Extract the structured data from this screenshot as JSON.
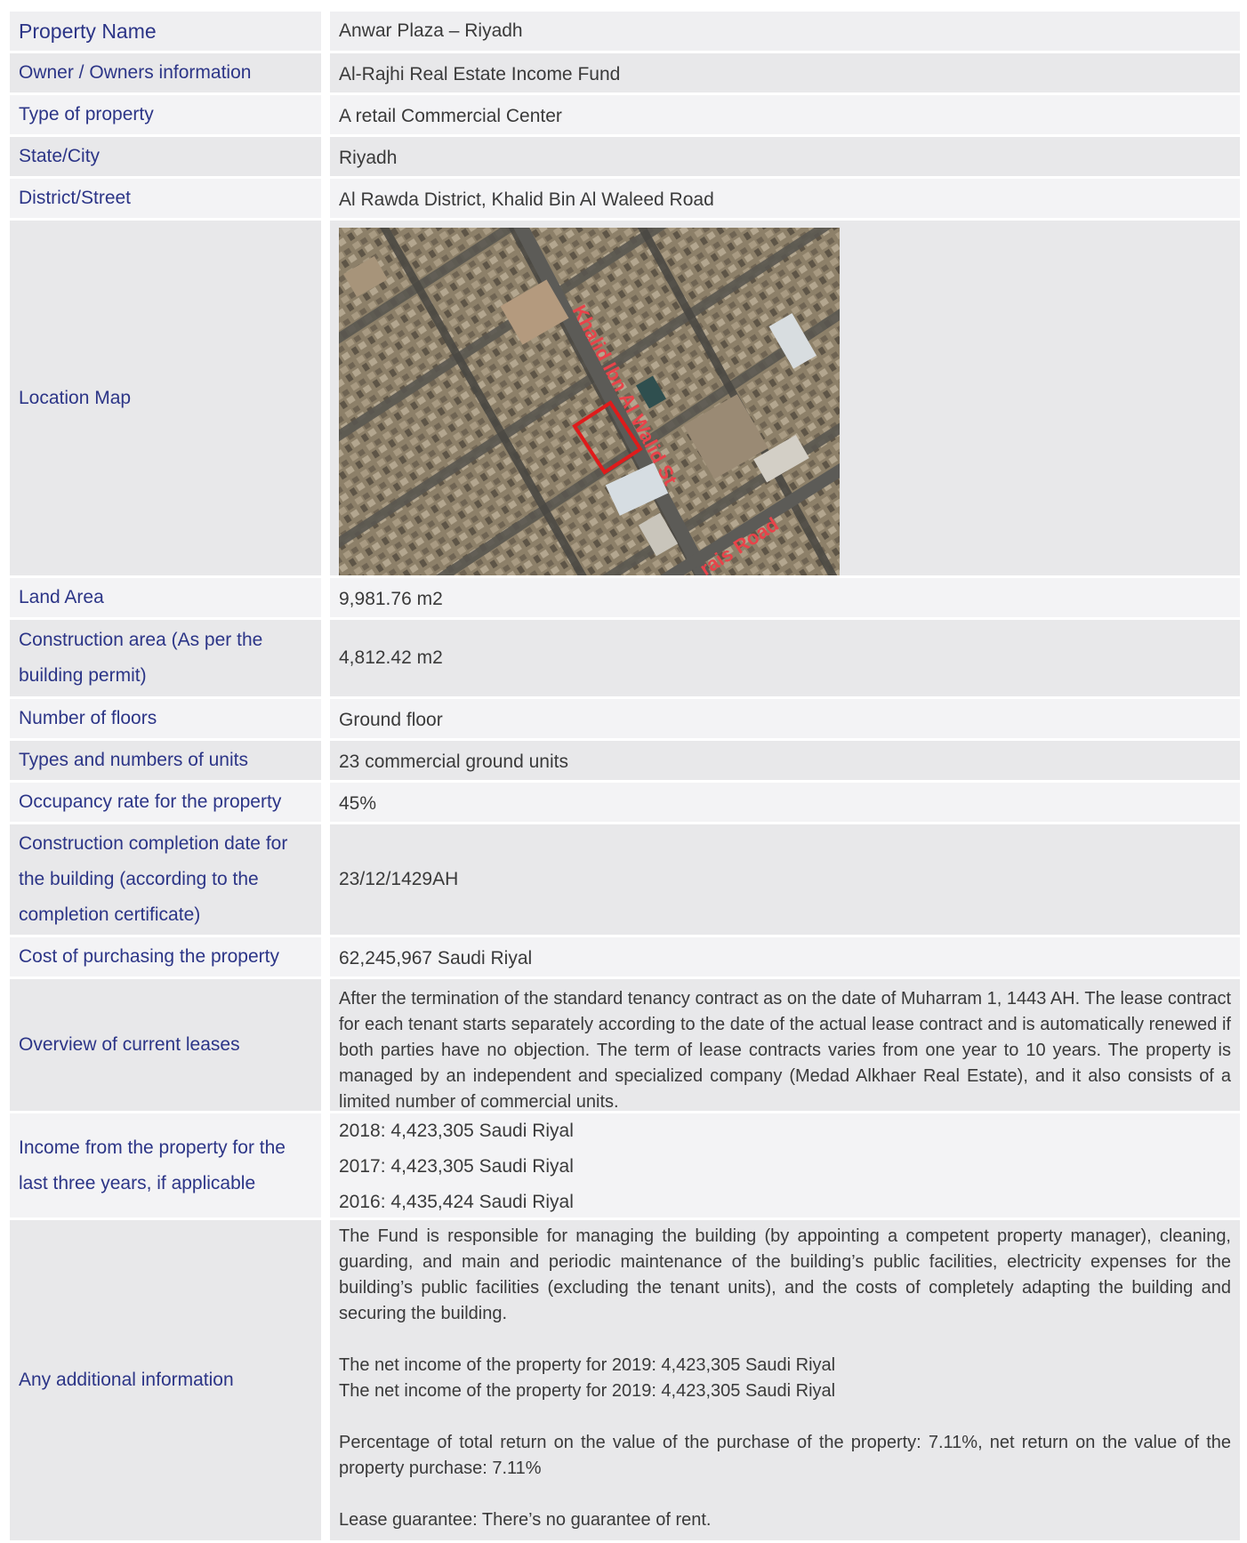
{
  "rows": {
    "property_name": {
      "label": "Property Name",
      "value": "Anwar Plaza – Riyadh"
    },
    "owner": {
      "label": "Owner / Owners information",
      "value": "Al-Rajhi Real Estate Income Fund"
    },
    "type": {
      "label": "Type of property",
      "value": "A retail Commercial Center"
    },
    "city": {
      "label": "State/City",
      "value": "Riyadh"
    },
    "district": {
      "label": "District/Street",
      "value": "Al Rawda District, Khalid Bin Al Waleed Road"
    },
    "map": {
      "label": "Location Map",
      "street_label_1": "Khalid Ibn Al Walid St",
      "street_label_2": "rais Road"
    },
    "land_area": {
      "label": "Land Area",
      "value": "9,981.76 m2"
    },
    "construction_area": {
      "label": "Construction area (As per the building permit)",
      "value": "4,812.42 m2"
    },
    "floors": {
      "label": "Number of floors",
      "value": "Ground floor"
    },
    "units": {
      "label": "Types and numbers of units",
      "value": "23 commercial ground units"
    },
    "occupancy": {
      "label": "Occupancy rate for the property",
      "value": "45%"
    },
    "completion": {
      "label": "Construction completion date for the building (according to the completion certificate)",
      "value": "23/12/1429AH"
    },
    "cost": {
      "label": "Cost of purchasing the property",
      "value": "62,245,967 Saudi Riyal"
    },
    "leases": {
      "label": "Overview of current leases",
      "value": "After the termination of the standard tenancy contract as on the date of Muharram 1, 1443 AH. The lease contract for each tenant starts separately according to the date of the actual lease contract and is automatically renewed if both parties have no objection. The term of lease contracts varies from one year to 10 years. The property is managed by an independent and specialized company (Medad Alkhaer Real Estate), and it also consists of a limited number of commercial units."
    },
    "income": {
      "label": "Income from the property for the last three years, if applicable",
      "lines": [
        "2018: 4,423,305 Saudi Riyal",
        "2017: 4,423,305 Saudi Riyal",
        "2016: 4,435,424 Saudi Riyal"
      ]
    },
    "additional": {
      "label": "Any additional information",
      "p1": "The Fund is responsible for managing the building (by appointing a competent property manager), cleaning, guarding, and main and periodic maintenance of the building’s public facilities, electricity expenses for the building’s public facilities (excluding the tenant units), and the costs of completely adapting the building and securing the building.",
      "p2a": "The net income of the property for 2019: 4,423,305 Saudi Riyal",
      "p2b": "The net income of the property for 2019: 4,423,305 Saudi Riyal",
      "p3": "Percentage of total return on the value of the purchase of the property: 7.11%, net return on the value of the property purchase: 7.11%",
      "p4": "Lease guarantee: There’s no guarantee of rent."
    }
  }
}
